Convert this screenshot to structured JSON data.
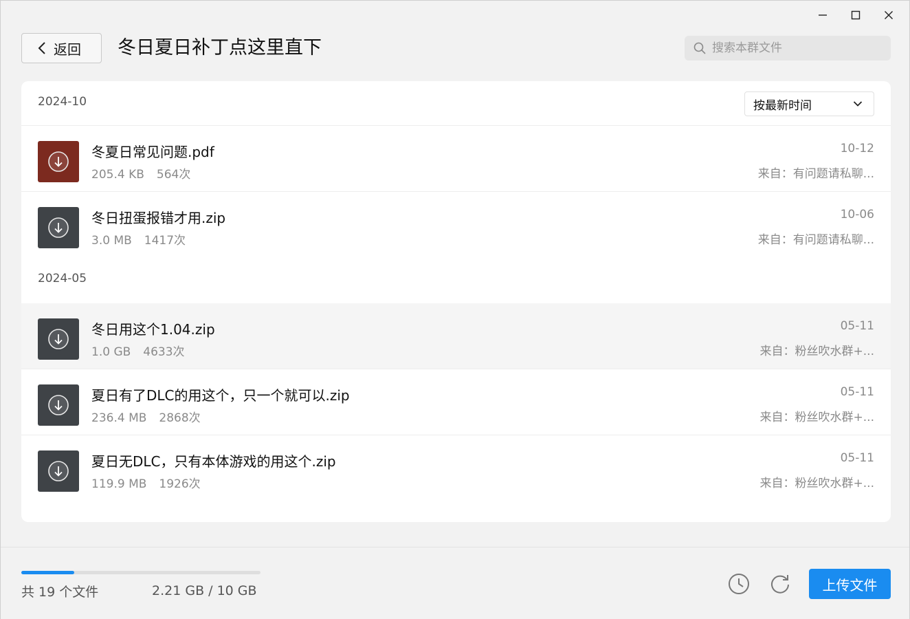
{
  "window": {
    "controls": [
      "minimize",
      "maximize",
      "close"
    ]
  },
  "header": {
    "back_label": "返回",
    "title": "冬日夏日补丁点这里直下",
    "search_placeholder": "搜索本群文件"
  },
  "sort": {
    "selected": "按最新时间"
  },
  "groups": [
    {
      "date": "2024-10",
      "files": [
        {
          "name": "冬夏日常见问题.pdf",
          "size": "205.4 KB",
          "downloads": "564次",
          "date": "10-12",
          "from": "来自：有问题请私聊...",
          "type": "pdf"
        },
        {
          "name": "冬日扭蛋报错才用.zip",
          "size": "3.0 MB",
          "downloads": "1417次",
          "date": "10-06",
          "from": "来自：有问题请私聊...",
          "type": "zip"
        }
      ]
    },
    {
      "date": "2024-05",
      "files": [
        {
          "name": "冬日用这个1.04.zip",
          "size": "1.0 GB",
          "downloads": "4633次",
          "date": "05-11",
          "from": "来自：粉丝吹水群+...",
          "type": "zip"
        },
        {
          "name": "夏日有了DLC的用这个，只一个就可以.zip",
          "size": "236.4 MB",
          "downloads": "2868次",
          "date": "05-11",
          "from": "来自：粉丝吹水群+...",
          "type": "zip"
        },
        {
          "name": "夏日无DLC，只有本体游戏的用这个.zip",
          "size": "119.9 MB",
          "downloads": "1926次",
          "date": "05-11",
          "from": "来自：粉丝吹水群+...",
          "type": "zip"
        }
      ]
    }
  ],
  "footer": {
    "file_count": "共 19 个文件",
    "storage": "2.21 GB / 10 GB",
    "storage_used_fraction": 0.221,
    "upload_label": "上传文件"
  },
  "colors": {
    "accent": "#1a8cf0",
    "pdf_icon": "#7c2a1f",
    "zip_icon": "#3f4347"
  },
  "icons": [
    "minimize-icon",
    "maximize-icon",
    "close-icon",
    "chevron-left-icon",
    "search-icon",
    "chevron-down-icon",
    "download-icon",
    "history-icon",
    "refresh-icon"
  ]
}
